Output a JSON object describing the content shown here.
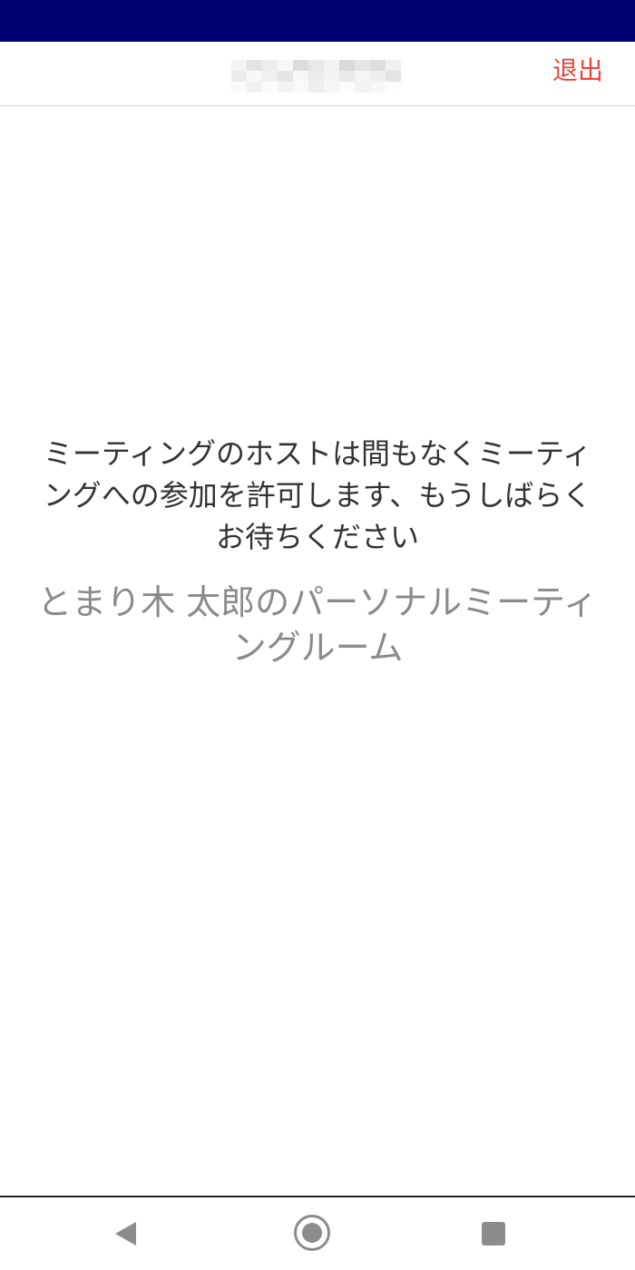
{
  "header": {
    "leave_label": "退出"
  },
  "main": {
    "waiting_message": "ミーティングのホストは間もなくミーティングへの参加を許可します、もうしばらくお待ちください",
    "room_name": "とまり木 太郎のパーソナルミーティングルーム"
  },
  "colors": {
    "status_bar": "#000075",
    "leave_text": "#e8443a",
    "message_text": "#333333",
    "room_text": "#8a8a8a"
  },
  "icons": {
    "back": "back-triangle-icon",
    "home": "home-circle-icon",
    "recents": "recents-square-icon"
  }
}
